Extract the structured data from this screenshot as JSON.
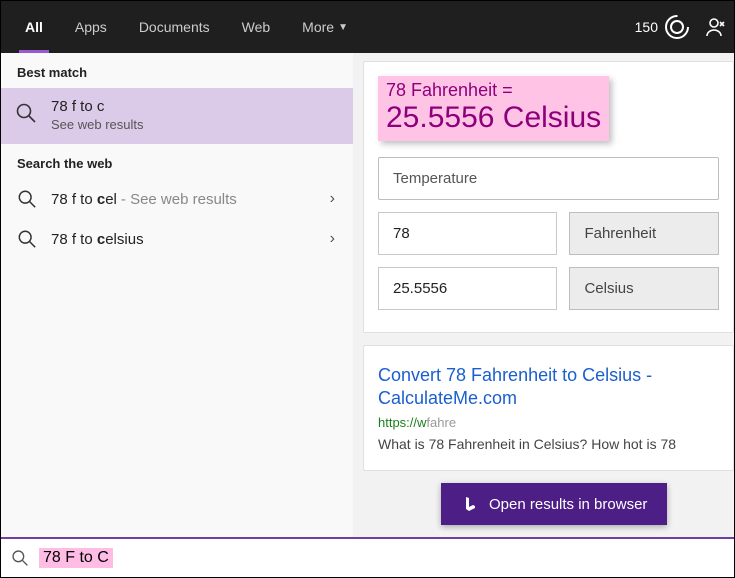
{
  "topbar": {
    "tabs": [
      "All",
      "Apps",
      "Documents",
      "Web",
      "More"
    ],
    "points": "150"
  },
  "left": {
    "best_match_label": "Best match",
    "best_match": {
      "title": "78 f to c",
      "sub": "See web results"
    },
    "search_web_label": "Search the web",
    "rows": [
      {
        "pre": "78 f to ",
        "bold": "c",
        "post": "el",
        "sub": "- See web results"
      },
      {
        "pre": "78 f to ",
        "bold": "c",
        "post": "elsius",
        "sub": ""
      }
    ]
  },
  "answer": {
    "head_top": "78 Fahrenheit =",
    "head_big": "25.5556 Celsius",
    "conv_type": "Temperature",
    "rows": [
      {
        "value": "78",
        "unit": "Fahrenheit"
      },
      {
        "value": "25.5556",
        "unit": "Celsius"
      }
    ]
  },
  "result": {
    "title": "Convert 78 Fahrenheit to Celsius - CalculateMe.com",
    "url_pre": "https://w",
    "url_post": "fahre",
    "snippet": "What is 78 Fahrenheit in Celsius? How hot is 78"
  },
  "open_browser": "Open results in browser",
  "search_value": "78 F to C"
}
